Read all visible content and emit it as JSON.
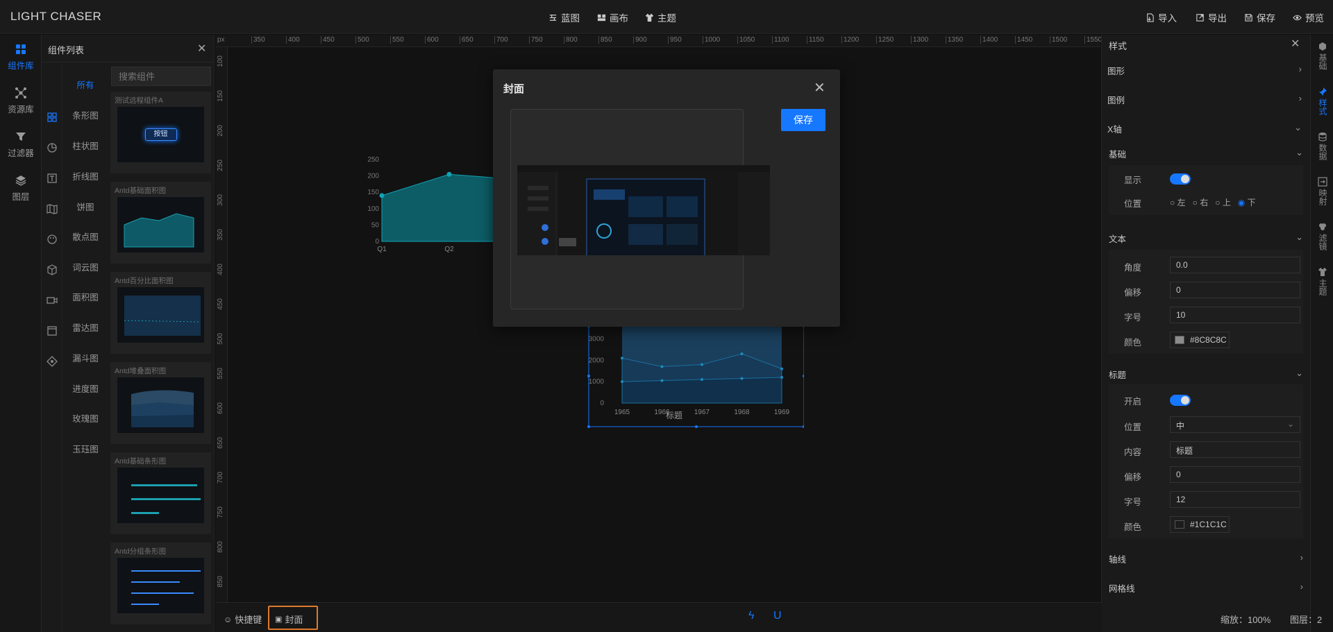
{
  "app": {
    "title": "LIGHT CHASER"
  },
  "header": {
    "center": [
      {
        "label": "蓝图"
      },
      {
        "label": "画布"
      },
      {
        "label": "主题"
      }
    ],
    "right": [
      {
        "label": "导入"
      },
      {
        "label": "导出"
      },
      {
        "label": "保存"
      },
      {
        "label": "预览"
      }
    ]
  },
  "leftnav": {
    "items": [
      {
        "label": "组件库",
        "icon": "grid-icon",
        "active": true
      },
      {
        "label": "资源库",
        "icon": "nodes-icon"
      },
      {
        "label": "过滤器",
        "icon": "filter-icon"
      },
      {
        "label": "图层",
        "icon": "layers-icon"
      }
    ]
  },
  "component_panel": {
    "title": "组件列表",
    "search_placeholder": "搜索组件",
    "categories": [
      "所有",
      "条形图",
      "柱状图",
      "折线图",
      "饼图",
      "散点图",
      "词云图",
      "面积图",
      "雷达图",
      "漏斗图",
      "进度图",
      "玫瑰图",
      "玉珏图"
    ],
    "cards": [
      {
        "title": "测试远程组件A",
        "button": "按钮"
      },
      {
        "title": "Antd基础面积图"
      },
      {
        "title": "Antd百分比面积图"
      },
      {
        "title": "Antd堆叠面积图"
      },
      {
        "title": "Antd基础条形图"
      },
      {
        "title": "Antd分组条形图"
      }
    ]
  },
  "ruler": {
    "unit": "px",
    "top_ticks": [
      "350",
      "400",
      "450",
      "500",
      "550",
      "600",
      "650",
      "700",
      "750",
      "800",
      "850",
      "900",
      "950",
      "1000",
      "1050",
      "1100",
      "1150",
      "1200",
      "1250",
      "1300",
      "1350",
      "1400",
      "1450",
      "1500",
      "1550"
    ],
    "left_ticks": [
      "100",
      "150",
      "200",
      "250",
      "300",
      "350",
      "400",
      "450",
      "500",
      "550",
      "600",
      "650",
      "700",
      "750",
      "800",
      "850"
    ]
  },
  "chart_data": [
    {
      "type": "area",
      "categories": [
        "Q1",
        "Q2"
      ],
      "values": [
        140,
        205,
        190
      ],
      "ylim": [
        0,
        250
      ],
      "yticks": [
        "250",
        "200",
        "150",
        "100",
        "50",
        "0"
      ],
      "color": "#0e7c8a"
    },
    {
      "type": "area",
      "categories": [
        "1965",
        "1966",
        "1967",
        "1968",
        "1969"
      ],
      "yticks": [
        "3000",
        "2000",
        "1000",
        "0"
      ],
      "ylim": [
        0,
        3500
      ],
      "series": [
        {
          "values": [
            2100,
            1700,
            1800,
            2300,
            1600
          ]
        },
        {
          "values": [
            1000,
            1050,
            1100,
            1150,
            1200
          ]
        }
      ],
      "title": "标题"
    }
  ],
  "modal": {
    "title": "封面",
    "save_label": "保存"
  },
  "right_panel": {
    "title": "样式",
    "sections": {
      "shape": "图形",
      "legend": "图例",
      "xaxis": "X轴"
    },
    "basic": {
      "title": "基础",
      "show_label": "显示",
      "position_label": "位置",
      "positions": [
        "左",
        "右",
        "上",
        "下"
      ],
      "selected_position": "下"
    },
    "text": {
      "title": "文本",
      "angle_label": "角度",
      "angle": "0.0",
      "offset_label": "偏移",
      "offset": "0",
      "size_label": "字号",
      "size": "10",
      "color_label": "颜色",
      "color": "#8C8C8C"
    },
    "titlesec": {
      "title": "标题",
      "enable_label": "开启",
      "position_label": "位置",
      "position": "中",
      "content_label": "内容",
      "content": "标题",
      "offset_label": "偏移",
      "offset": "0",
      "size_label": "字号",
      "size": "12",
      "color_label": "颜色",
      "color": "#1C1C1C"
    },
    "axisline": "轴线",
    "gridline": "网格线"
  },
  "right_tabs": [
    {
      "label": "基础",
      "icon": "gem-icon"
    },
    {
      "label": "样式",
      "icon": "pin-icon",
      "active": true
    },
    {
      "label": "数据",
      "icon": "database-icon"
    },
    {
      "label": "映射",
      "icon": "map-icon"
    },
    {
      "label": "滤镜",
      "icon": "filter-circles-icon"
    },
    {
      "label": "主题",
      "icon": "shirt-icon"
    }
  ],
  "footer": {
    "shortcut": "快捷键",
    "cover": "封面",
    "zoom": "缩放：100%",
    "layers": "图层：2"
  },
  "colors": {
    "accent": "#1677ff",
    "highlight": "#e07a2e",
    "chart": "#0e7c8a"
  }
}
